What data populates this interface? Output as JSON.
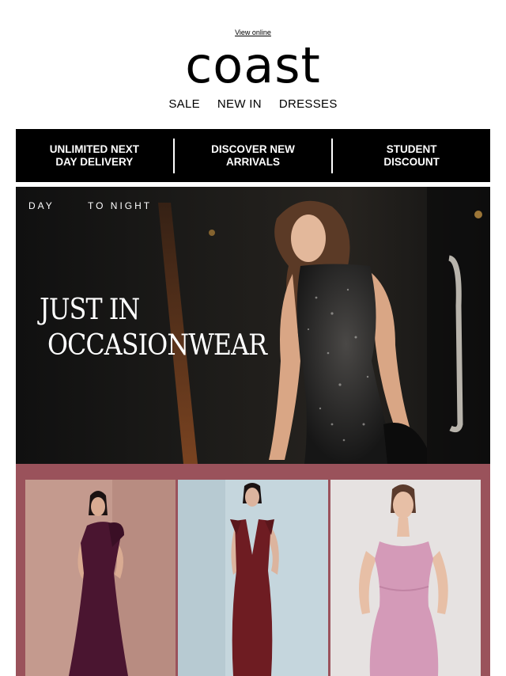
{
  "header": {
    "view_online": "View online",
    "logo": "coast",
    "nav": [
      "SALE",
      "NEW IN",
      "DRESSES"
    ]
  },
  "promo": {
    "items": [
      {
        "line1": "UNLIMITED NEXT",
        "line2": "DAY DELIVERY"
      },
      {
        "line1": "DISCOVER NEW",
        "line2": "ARRIVALS"
      },
      {
        "line1": "STUDENT",
        "line2": "DISCOUNT"
      }
    ]
  },
  "hero": {
    "tag_left": "DAY",
    "tag_right": "TO NIGHT",
    "title_line1": "JUST IN",
    "title_line2": "OCCASIONWEAR"
  },
  "colors": {
    "promo_bg": "#000000",
    "products_bg": "#9a525b",
    "dress_plum": "#4a1530",
    "dress_burgundy": "#6e1c22",
    "dress_lilac": "#d49ab8"
  }
}
